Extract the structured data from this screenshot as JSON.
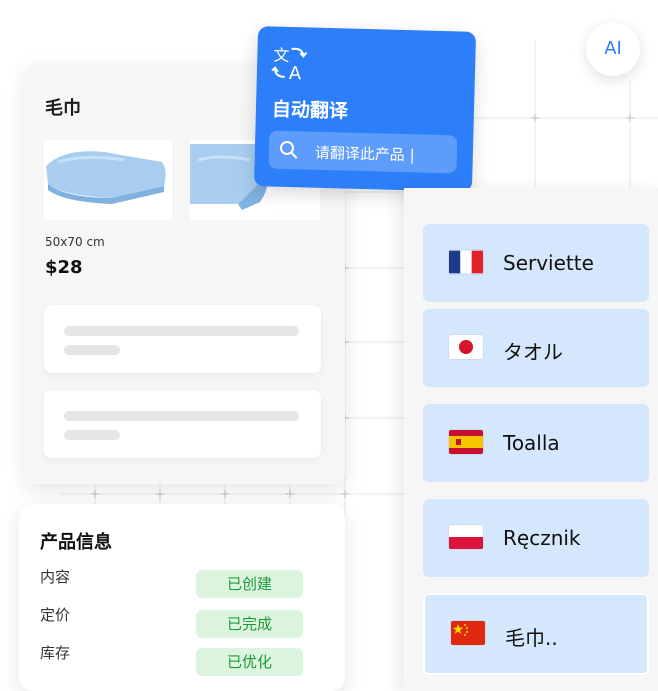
{
  "ai_badge": "AI",
  "translate": {
    "title": "自动翻译",
    "search_placeholder": "请翻译此产品 |"
  },
  "product": {
    "name": "毛巾",
    "size": "50x70 cm",
    "price": "$28"
  },
  "languages": [
    {
      "label": "Serviette",
      "flag": "france-flag"
    },
    {
      "label": "タオル",
      "flag": "japan-flag"
    },
    {
      "label": "Toalla",
      "flag": "spain-flag"
    },
    {
      "label": "Ręcznik",
      "flag": "poland-flag"
    },
    {
      "label": "毛巾..",
      "flag": "china-flag"
    }
  ],
  "info": {
    "title": "产品信息",
    "rows": [
      {
        "label": "内容",
        "status": "已创建"
      },
      {
        "label": "定价",
        "status": "已完成"
      },
      {
        "label": "库存",
        "status": "已优化"
      }
    ]
  },
  "colors": {
    "accent_blue": "#2d7ff9",
    "language_tile": "#d5e7fd",
    "status_green": "#1e9a3a",
    "status_bg": "#dcf5df"
  }
}
